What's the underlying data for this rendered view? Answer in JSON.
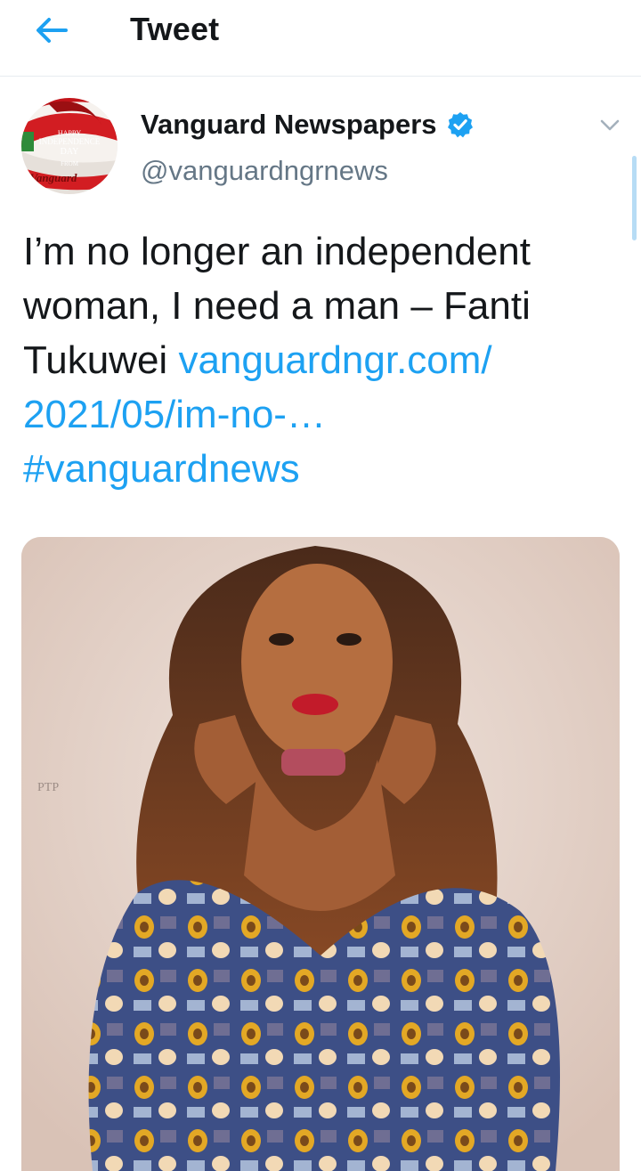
{
  "topbar": {
    "title": "Tweet",
    "back_icon": "arrow-left-icon"
  },
  "tweet": {
    "author": {
      "display_name": "Vanguard Newspapers",
      "handle": "@vanguardngrnews",
      "verified": true,
      "avatar_text": {
        "line1": "HAPPY",
        "line2": "INDEPENDENCE",
        "line3": "DAY",
        "line4": "FROM",
        "line5": "Vanguard"
      }
    },
    "text": {
      "body": "I’m no longer an independent woman, I need a man – Fanti Tukuwei ",
      "link": "vanguardngr.com/ 2021/05/im-no-…",
      "hashtag": "#vanguardnews"
    },
    "media": {
      "watermark": "PTP"
    }
  },
  "colors": {
    "accent": "#1da1f2",
    "text": "#14171a",
    "secondary": "#657786",
    "verified_badge": "#1da1f2"
  }
}
